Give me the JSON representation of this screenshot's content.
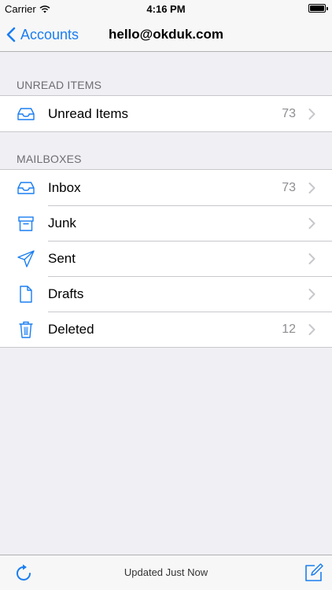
{
  "status_bar": {
    "carrier": "Carrier",
    "time": "4:16 PM"
  },
  "navbar": {
    "back_label": "Accounts",
    "title": "hello@okduk.com"
  },
  "sections": {
    "unread": {
      "header": "UNREAD ITEMS",
      "items": [
        {
          "label": "Unread Items",
          "count": "73",
          "icon": "tray-icon"
        }
      ]
    },
    "mailboxes": {
      "header": "MAILBOXES",
      "items": [
        {
          "label": "Inbox",
          "count": "73",
          "icon": "inbox-tray-icon"
        },
        {
          "label": "Junk",
          "count": "",
          "icon": "archive-box-icon"
        },
        {
          "label": "Sent",
          "count": "",
          "icon": "paper-plane-icon"
        },
        {
          "label": "Drafts",
          "count": "",
          "icon": "document-icon"
        },
        {
          "label": "Deleted",
          "count": "12",
          "icon": "trash-icon"
        }
      ]
    }
  },
  "toolbar": {
    "status": "Updated Just Now"
  },
  "colors": {
    "accent": "#1a7ef2",
    "background": "#efeff4",
    "secondary_text": "#8e8e93"
  }
}
